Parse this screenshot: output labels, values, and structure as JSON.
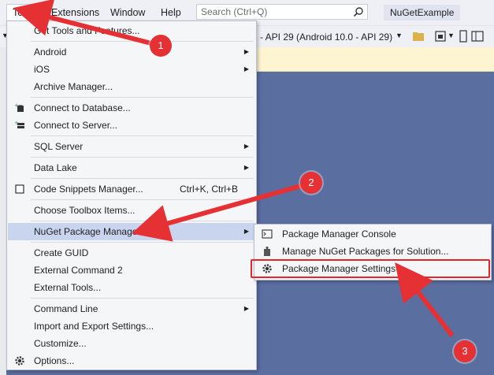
{
  "menubar": {
    "items": [
      "Tools",
      "Extensions",
      "Window",
      "Help"
    ],
    "search_placeholder": "Search (Ctrl+Q)",
    "project_name": "NuGetExample"
  },
  "toolbar": {
    "target_text": "- API 29 (Android 10.0 - API 29)"
  },
  "tools_menu": {
    "items": [
      {
        "label": "Get Tools and Features...",
        "icon": ""
      },
      {
        "label": "Android",
        "submenu": true
      },
      {
        "label": "iOS",
        "submenu": true
      },
      {
        "label": "Archive Manager..."
      },
      {
        "label": "Connect to Database...",
        "icon": "database-plus-icon"
      },
      {
        "label": "Connect to Server...",
        "icon": "server-plus-icon"
      },
      {
        "label": "SQL Server",
        "submenu": true
      },
      {
        "label": "Data Lake",
        "submenu": true
      },
      {
        "label": "Code Snippets Manager...",
        "shortcut": "Ctrl+K, Ctrl+B",
        "icon": "checkbox-icon"
      },
      {
        "label": "Choose Toolbox Items..."
      },
      {
        "label": "NuGet Package Manager",
        "submenu": true
      },
      {
        "label": "Create GUID"
      },
      {
        "label": "External Command 2"
      },
      {
        "label": "External Tools..."
      },
      {
        "label": "Command Line",
        "submenu": true
      },
      {
        "label": "Import and Export Settings..."
      },
      {
        "label": "Customize..."
      },
      {
        "label": "Options...",
        "icon": "gear-icon"
      }
    ]
  },
  "nuget_submenu": {
    "items": [
      {
        "label": "Package Manager Console",
        "icon": "console-icon"
      },
      {
        "label": "Manage NuGet Packages for Solution...",
        "icon": "package-icon"
      },
      {
        "label": "Package Manager Settings",
        "icon": "gear-icon"
      }
    ]
  },
  "annotations": {
    "badges": [
      "1",
      "2",
      "3"
    ],
    "color": "#e53034"
  }
}
